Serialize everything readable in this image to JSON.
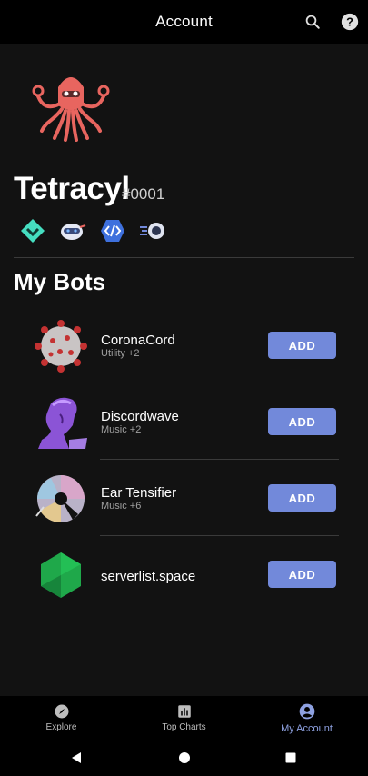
{
  "appbar": {
    "title": "Account",
    "icons": [
      "search-icon",
      "help-icon"
    ]
  },
  "profile": {
    "username": "Tetracyl",
    "discriminator": "#0001",
    "badges": [
      "hypesquad-balance-badge",
      "bot-dev-badge",
      "developer-badge",
      "server-booster-badge"
    ]
  },
  "section": {
    "title": "My Bots"
  },
  "bots": [
    {
      "name": "CoronaCord",
      "subtitle": "Utility +2",
      "add_label": "ADD",
      "image": "coronavirus"
    },
    {
      "name": "Discordwave",
      "subtitle": "Music +2",
      "add_label": "ADD",
      "image": "purple-statue"
    },
    {
      "name": "Ear Tensifier",
      "subtitle": "Music +6",
      "add_label": "ADD",
      "image": "shattered-cd"
    },
    {
      "name": "serverlist.space",
      "subtitle": "",
      "add_label": "ADD",
      "image": "green-hexagon"
    }
  ],
  "bottom_nav": [
    {
      "label": "Explore",
      "icon": "compass-icon",
      "active": false
    },
    {
      "label": "Top Charts",
      "icon": "bar-chart-icon",
      "active": false
    },
    {
      "label": "My Account",
      "icon": "account-circle-icon",
      "active": true
    }
  ],
  "colors": {
    "accent": "#7289da",
    "active_nav": "#8ea1e1",
    "background": "#121212"
  }
}
